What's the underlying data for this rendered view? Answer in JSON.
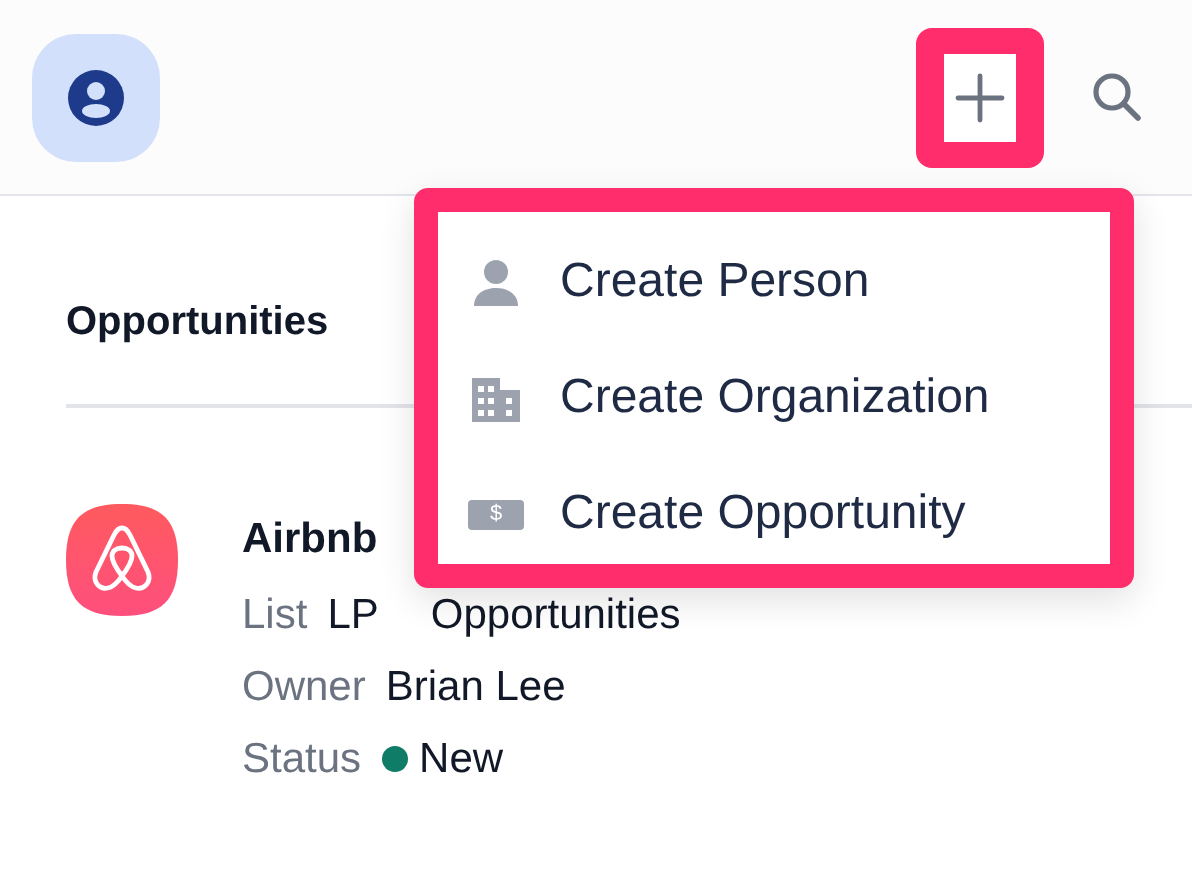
{
  "header": {
    "add_button": {
      "highlighted": true
    }
  },
  "section": {
    "title": "Opportunities"
  },
  "record": {
    "name": "Airbnb",
    "fields": [
      {
        "kind": "text",
        "label": "List",
        "value": "LP",
        "value_2": "Opportunities"
      },
      {
        "kind": "text",
        "label": "Owner",
        "value": "Brian Lee"
      },
      {
        "kind": "status",
        "label": "Status",
        "value": "New",
        "color": "#0e7c66"
      }
    ]
  },
  "create_menu": {
    "highlighted": true,
    "items": [
      {
        "kind": "person",
        "label": "Create Person"
      },
      {
        "kind": "organization",
        "label": "Create Organization"
      },
      {
        "kind": "opportunity",
        "label": "Create Opportunity",
        "icon_text": "$"
      }
    ]
  }
}
